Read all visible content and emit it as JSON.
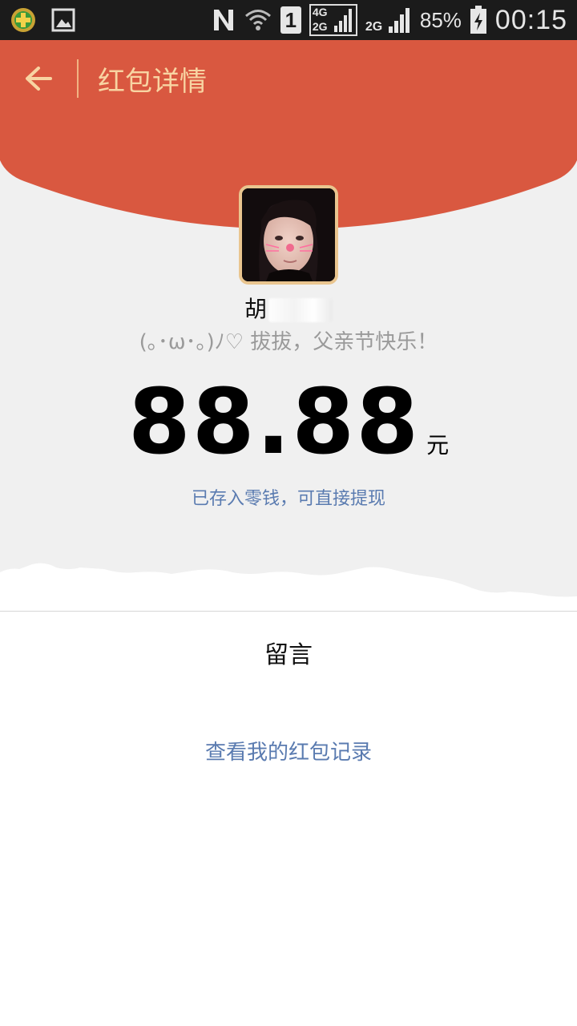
{
  "status_bar": {
    "battery_percent": "85%",
    "time": "00:15",
    "network_4g": "4G",
    "network_2g_top": "2G",
    "network_2g": "2G",
    "sim_number": "1",
    "icons": [
      "app-plus-icon",
      "gallery-icon",
      "nfc-icon",
      "wifi-icon",
      "sim-icon",
      "signal-icon",
      "signal-2g-icon",
      "battery-charging-icon"
    ]
  },
  "header": {
    "title": "红包详情",
    "back_icon": "arrow-left-icon",
    "color": "#d95840",
    "title_color": "#f8d4a2"
  },
  "packet": {
    "sender_name_visible": "胡",
    "greeting": "(｡･ω･｡)ﾉ♡   拔拔，父亲节快乐！",
    "amount": "88.88",
    "unit": "元",
    "stored_note": "已存入零钱，可直接提现"
  },
  "footer": {
    "message_label": "留言",
    "records_link": "查看我的红包记录"
  },
  "colors": {
    "link": "#5a7bb0",
    "background_upper": "#f0f0f0",
    "background_lower": "#ffffff"
  }
}
